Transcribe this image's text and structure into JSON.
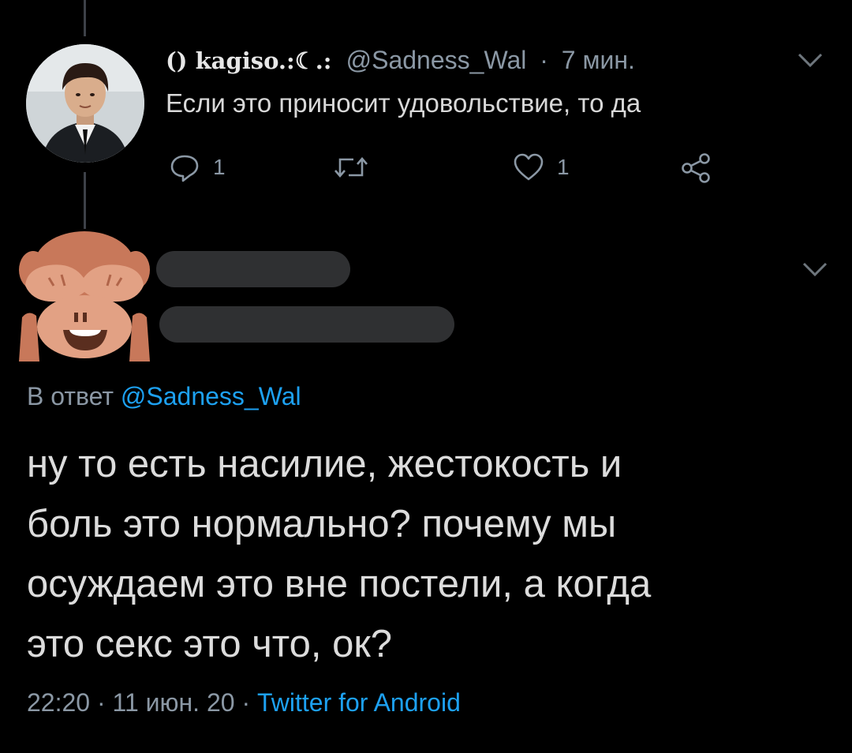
{
  "parent_tweet": {
    "display_name": "kagiso.:☾.:",
    "name_badge": "()",
    "handle": "@Sadness_Wal",
    "separator": "·",
    "time": "7 мин.",
    "text": "Если это приносит удовольствие, то да",
    "reply_count": "1",
    "like_count": "1",
    "icons": [
      "reply-icon",
      "retweet-icon",
      "like-icon",
      "share-icon",
      "chevron-down-icon"
    ]
  },
  "main_tweet": {
    "reply_prefix": "В ответ",
    "reply_handle": "@Sadness_Wal",
    "text_lines": [
      "ну то есть насилие, жестокость и",
      "боль это нормально? почему мы",
      "осуждаем это вне постели, а когда",
      "это секс это что, ок?"
    ],
    "time": "22:20",
    "separator": "·",
    "date": "11 июн. 20",
    "source": "Twitter for Android",
    "avatar_icon": "see-no-evil-monkey-icon"
  },
  "colors": {
    "background": "#000000",
    "text": "#d9d9d9",
    "muted": "#8b98a5",
    "link": "#1da1f2",
    "thread_line": "#3d4148",
    "redacted": "#2f3032"
  }
}
